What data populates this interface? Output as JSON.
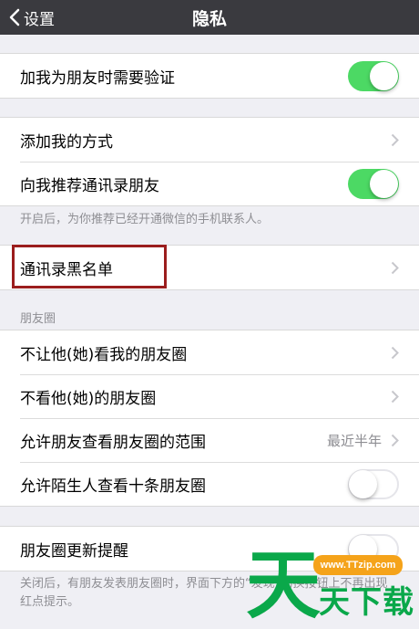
{
  "nav": {
    "back_label": "设置",
    "title": "隐私"
  },
  "group1": {
    "items": [
      {
        "label": "加我为朋友时需要验证",
        "toggle": "on"
      }
    ]
  },
  "group2": {
    "items": [
      {
        "label": "添加我的方式"
      },
      {
        "label": "向我推荐通讯录朋友",
        "toggle": "on"
      }
    ],
    "note": "开启后，为你推荐已经开通微信的手机联系人。"
  },
  "group3": {
    "items": [
      {
        "label": "通讯录黑名单"
      }
    ]
  },
  "moments": {
    "header": "朋友圈",
    "items": [
      {
        "label": "不让他(她)看我的朋友圈"
      },
      {
        "label": "不看他(她)的朋友圈"
      },
      {
        "label": "允许朋友查看朋友圈的范围",
        "value": "最近半年"
      },
      {
        "label": "允许陌生人查看十条朋友圈",
        "toggle": "off"
      }
    ]
  },
  "group5": {
    "items": [
      {
        "label": "朋友圈更新提醒",
        "toggle": "off"
      }
    ],
    "note": "关闭后，有朋友发表朋友圈时，界面下方的“发现”切换按钮上不再出现红点提示。"
  },
  "watermark": {
    "url": "www.TTzip.com",
    "big": "天",
    "small": "天下载"
  },
  "colors": {
    "nav_bg": "#3a3a3f",
    "toggle_on": "#4cd964",
    "highlight": "#9b1d1d",
    "watermark_green": "#0aa84a",
    "watermark_orange": "#f5a31a"
  }
}
